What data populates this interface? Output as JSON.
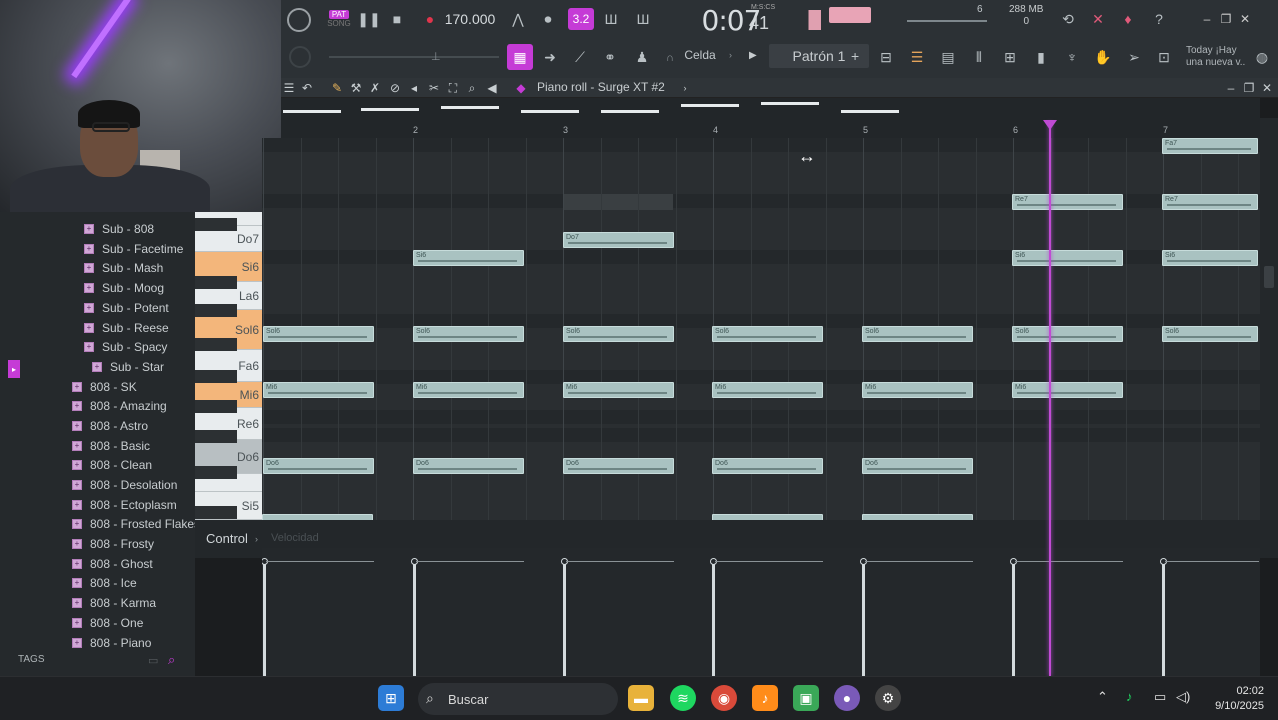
{
  "toolbar": {
    "pat_label": "PAT",
    "song_label": "SONG",
    "tempo": "170.000",
    "time_main": "0:07",
    "time_sub": "41",
    "time_format": "M:S:CS",
    "memory": "288 MB",
    "memory_sub": "0",
    "cpu_count": "6",
    "snap_label": "Celda",
    "pattern_label": "Patrón 1",
    "hint_line1": "Today ¡Hay",
    "hint_line2": "una nueva v..",
    "step_label": "3.2"
  },
  "piano_roll": {
    "title": "Piano roll - Surge XT #2",
    "bars": [
      "2",
      "3",
      "4",
      "5",
      "6",
      "7"
    ],
    "keys": [
      {
        "label": "Do7"
      },
      {
        "label": "Si6"
      },
      {
        "label": "La6"
      },
      {
        "label": "Sol6"
      },
      {
        "label": "Fa6"
      },
      {
        "label": "Mi6"
      },
      {
        "label": "Re6"
      },
      {
        "label": "Do6"
      },
      {
        "label": "Si5"
      }
    ],
    "notes": [
      {
        "label": "Fa7"
      },
      {
        "label": "Re7"
      },
      {
        "label": "Re7"
      },
      {
        "label": "Do7"
      },
      {
        "label": "Si6"
      },
      {
        "label": "Si6"
      },
      {
        "label": "Si6"
      },
      {
        "label": "Sol6"
      },
      {
        "label": "Sol6"
      },
      {
        "label": "Sol6"
      },
      {
        "label": "Sol6"
      },
      {
        "label": "Sol6"
      },
      {
        "label": "Sol6"
      },
      {
        "label": "Sol6"
      },
      {
        "label": "Mi6"
      },
      {
        "label": "Mi6"
      },
      {
        "label": "Mi6"
      },
      {
        "label": "Mi6"
      },
      {
        "label": "Mi6"
      },
      {
        "label": "Mi6"
      },
      {
        "label": "Do6"
      },
      {
        "label": "Do6"
      },
      {
        "label": "Do6"
      },
      {
        "label": "Do6"
      },
      {
        "label": "Do6"
      }
    ],
    "control_label": "Control",
    "control_param": "Velocidad"
  },
  "browser": {
    "items": [
      {
        "label": "Sub - 808"
      },
      {
        "label": "Sub - Facetime"
      },
      {
        "label": "Sub - Mash"
      },
      {
        "label": "Sub - Moog"
      },
      {
        "label": "Sub - Potent"
      },
      {
        "label": "Sub - Reese"
      },
      {
        "label": "Sub - Spacy"
      },
      {
        "label": "Sub - Star"
      },
      {
        "label": "808 - SK"
      },
      {
        "label": "808 - Amazing"
      },
      {
        "label": "808 - Astro"
      },
      {
        "label": "808 - Basic"
      },
      {
        "label": "808 - Clean"
      },
      {
        "label": "808 - Desolation"
      },
      {
        "label": "808 - Ectoplasm"
      },
      {
        "label": "808 - Frosted Flakes"
      },
      {
        "label": "808 - Frosty"
      },
      {
        "label": "808 - Ghost"
      },
      {
        "label": "808 - Ice"
      },
      {
        "label": "808 - Karma"
      },
      {
        "label": "808 - One"
      },
      {
        "label": "808 - Piano"
      }
    ],
    "tags_label": "TAGS"
  },
  "taskbar": {
    "search_label": "Buscar",
    "time": "02:02",
    "date": "9/10/2025"
  },
  "colors": {
    "accent": "#c53bd6",
    "note": "#a9c2c1",
    "highlight_key": "#f3b67b",
    "playhead": "#c14bd4"
  }
}
